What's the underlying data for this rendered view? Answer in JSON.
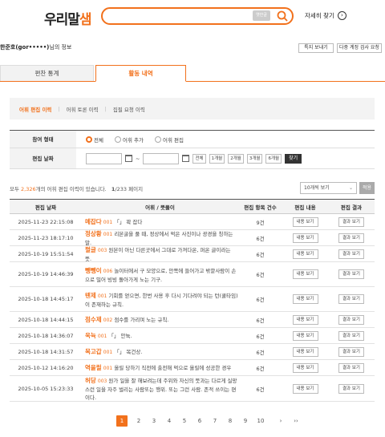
{
  "header": {
    "logo_main": "우리말",
    "logo_accent": "샘",
    "keyboard_label": "옛한글",
    "detail_search": "자세히 찾기",
    "detail_search_icon": "›"
  },
  "user": {
    "name": "한준호(gor•••••)",
    "suffix": "님의 정보",
    "btn_view": "특지 보내기",
    "btn_multi": "다중 계정 검사 요청"
  },
  "tabs": [
    {
      "label": "편찬 통계"
    },
    {
      "label": "활동 내역"
    }
  ],
  "subnav": [
    {
      "label": "어휘 편집 이력"
    },
    {
      "label": "어휘 토론 이력"
    },
    {
      "label": "집필 요청 이력"
    }
  ],
  "filter": {
    "type_label": "참여 형태",
    "type_options": [
      "전체",
      "어휘 추가",
      "어휘 편집"
    ],
    "date_label": "편집 날짜",
    "range_sep": "~",
    "ranges": [
      "전체",
      "1개월",
      "2개월",
      "3개월",
      "6개월"
    ],
    "lookup": "찾기"
  },
  "summary": {
    "prefix": "모두 ",
    "count": "2,326",
    "middle": "개의 어휘 편집 이력이 있습니다.",
    "page_cur": "1",
    "page_total": "/233 페이지"
  },
  "select": {
    "value": "10개씩 보기",
    "arrow": "⌄",
    "apply": "적용"
  },
  "table": {
    "headers": [
      "편집 날짜",
      "어휘 / 뜻풀이",
      "편집 항목 건수",
      "편집 내용",
      "편집 결과"
    ],
    "btn_content": "내용 보기",
    "btn_result": "결과 보기",
    "rows": [
      {
        "date": "2025-11-23 22:15:08",
        "word": "메잡다",
        "num": "001",
        "desc": "「」 꽉 잡다",
        "count": "9건"
      },
      {
        "date": "2025-11-23 18:17:10",
        "word": "정상황",
        "num": "001",
        "desc": "리본굴을 풀 때, 정상에서 먹은 사진이나 광경을 칭하는 말.",
        "count": "6건"
      },
      {
        "date": "2025-10-19 15:51:54",
        "word": "펄글",
        "num": "003",
        "desc": "원본이 아닌 다른곳에서 그대로 가져다온, 퍼온 글이라는 뜻.",
        "count": "6건"
      },
      {
        "date": "2025-10-19 14:46:39",
        "word": "뺑뺑이",
        "num": "006",
        "desc": "놀이터에서 구 모양으로, 안쪽에 들어가고 밖깥사람이 손으로 밀어 빙빙 돌아가게 노는 기구.",
        "count": "6건"
      },
      {
        "date": "2025-10-18 14:45:17",
        "word": "텐제",
        "num": "001",
        "desc": "기회를 얻으면, 한번 사용 후 다시 기다려야 되는 턴(쿨타임)이 존재하는 규칙.",
        "count": "6건"
      },
      {
        "date": "2025-10-18 14:44:15",
        "word": "점수제",
        "num": "002",
        "desc": "점수를 가리며 노는 규칙.",
        "count": "6건"
      },
      {
        "date": "2025-10-18 14:36:07",
        "word": "욱뉵",
        "num": "001",
        "desc": "「」 안뉵.",
        "count": "6건"
      },
      {
        "date": "2025-10-18 14:31:57",
        "word": "목고갑",
        "num": "001",
        "desc": "「」 목건상.",
        "count": "6건"
      },
      {
        "date": "2025-10-12 14:16:20",
        "word": "역을릴",
        "num": "001",
        "desc": "올릴 당하기 직전에 출전해 먹으로 올릴에 성공한 경우",
        "count": "6건"
      },
      {
        "date": "2025-10-05 15:23:33",
        "word": "허당",
        "num": "003",
        "desc": "원가 일을 잘 해보려는데 주위와 자신의 뜻과는 다르게 실망스런 일을 자주 벌리는 사람또는 행위. 또는 그런 사람. 존적 쓰이는 편이다.",
        "count": "6건"
      }
    ]
  },
  "pagination": {
    "pages": [
      "1",
      "2",
      "3",
      "4",
      "5",
      "6",
      "7",
      "8",
      "9",
      "10"
    ],
    "next": "›",
    "last": "››"
  },
  "colors": {
    "accent": "#f2711c"
  }
}
